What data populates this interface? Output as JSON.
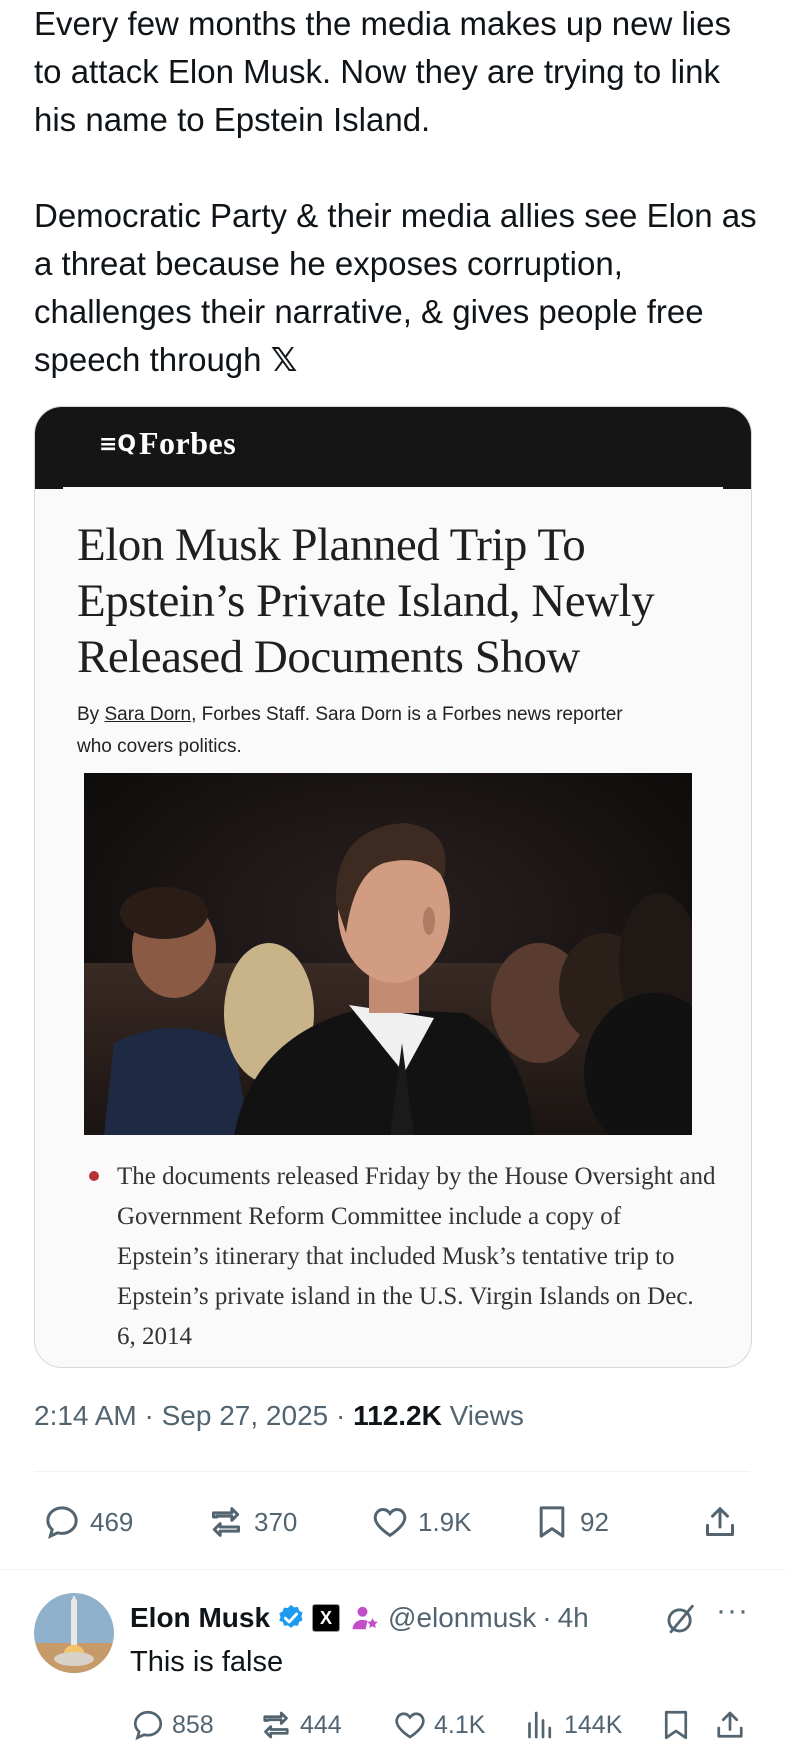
{
  "post": {
    "paragraph1": "Every few months the media makes up new lies to attack Elon Musk. Now they are trying to link his name to Epstein Island.",
    "paragraph2": "Democratic Party & their media allies see Elon as a threat because he exposes corruption, challenges their narrative, & gives people free speech through",
    "x_glyph": "𝕏"
  },
  "card": {
    "menu_icon": "≡Q",
    "publication": "Forbes",
    "headline": "Elon Musk Planned Trip To Epstein’s Private Island, Newly Released Documents Show",
    "byline_prefix": "By",
    "author": "Sara Dorn",
    "byline_rest": ", Forbes Staff.  Sara Dorn is a Forbes news reporter who covers politics.",
    "bullet": "The documents released Friday by the House Oversight and Government Reform Committee include a copy of Epstein’s itinerary that included Musk’s tentative trip to Epstein’s private island in the U.S. Virgin Islands on Dec. 6, 2014",
    "photo_icon": "news-photo"
  },
  "meta": {
    "time": "2:14 AM",
    "sep1": "·",
    "date": "Sep 27, 2025",
    "sep2": "·",
    "views": "112.2K",
    "views_label": "Views"
  },
  "actions": {
    "replies": "469",
    "reposts": "370",
    "likes": "1.9K",
    "bookmarks": "92"
  },
  "reply": {
    "name": "Elon Musk",
    "affiliate_badge": "X",
    "handle": "@elonmusk",
    "sep": "·",
    "age": "4h",
    "more": "···",
    "text": "This is false",
    "replies": "858",
    "reposts": "444",
    "likes": "4.1K",
    "views": "144K"
  },
  "colors": {
    "verified_blue": "#1d9bf0",
    "secondary_text": "#536471",
    "forbes_header": "#151515",
    "bullet_red": "#b5343a"
  }
}
